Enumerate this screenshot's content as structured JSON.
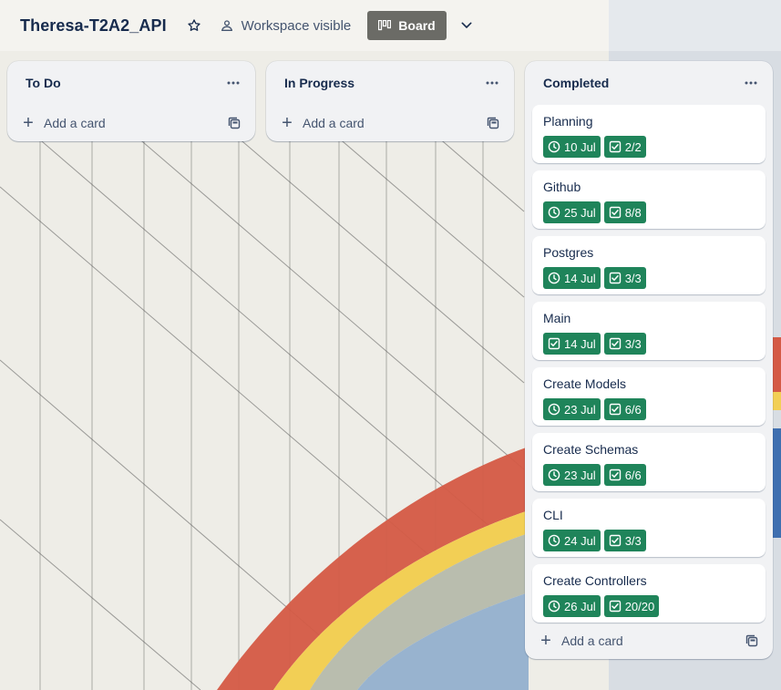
{
  "board": {
    "title": "Theresa-T2A2_API",
    "visibility_label": "Workspace visible",
    "view_label": "Board"
  },
  "colors": {
    "badge_complete": "#1f845a",
    "list_bg": "#f1f2f4",
    "title_text": "#172b4d"
  },
  "lists": {
    "todo": {
      "title": "To Do",
      "add_card_label": "Add a card"
    },
    "progress": {
      "title": "In Progress",
      "add_card_label": "Add a card"
    },
    "completed": {
      "title": "Completed",
      "add_card_label": "Add a card",
      "cards": [
        {
          "title": "Planning",
          "due": "10 Jul",
          "due_icon": "clock-icon",
          "checklist": "2/2"
        },
        {
          "title": "Github",
          "due": "25 Jul",
          "due_icon": "clock-icon",
          "checklist": "8/8"
        },
        {
          "title": "Postgres",
          "due": "14 Jul",
          "due_icon": "clock-icon",
          "checklist": "3/3"
        },
        {
          "title": "Main",
          "due": "14 Jul",
          "due_icon": "checkbox-icon",
          "checklist": "3/3"
        },
        {
          "title": "Create Models",
          "due": "23 Jul",
          "due_icon": "clock-icon",
          "checklist": "6/6"
        },
        {
          "title": "Create Schemas",
          "due": "23 Jul",
          "due_icon": "clock-icon",
          "checklist": "6/6"
        },
        {
          "title": "CLI",
          "due": "24 Jul",
          "due_icon": "clock-icon",
          "checklist": "3/3"
        },
        {
          "title": "Create Controllers",
          "due": "26 Jul",
          "due_icon": "clock-icon",
          "checklist": "20/20"
        }
      ]
    }
  }
}
